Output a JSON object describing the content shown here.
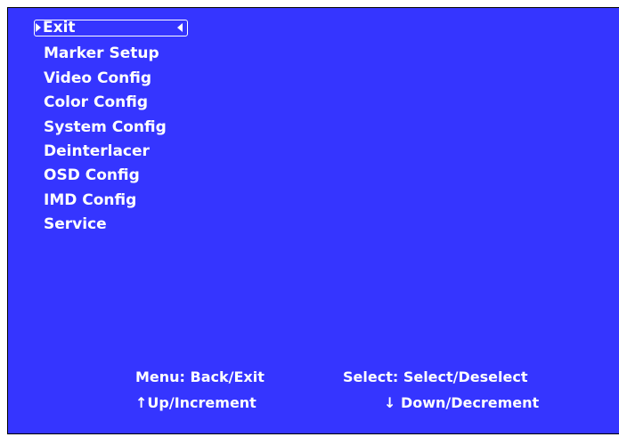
{
  "menu": {
    "items": [
      {
        "label": "Exit",
        "selected": true
      },
      {
        "label": "Marker Setup"
      },
      {
        "label": "Video Config"
      },
      {
        "label": "Color Config"
      },
      {
        "label": "System Config"
      },
      {
        "label": "Deinterlacer"
      },
      {
        "label": "OSD Config"
      },
      {
        "label": "IMD Config"
      },
      {
        "label": "Service"
      }
    ]
  },
  "help": {
    "menu_hint": "Menu: Back/Exit",
    "select_hint": "Select: Select/Deselect",
    "up_hint": "↑Up/Increment",
    "down_hint": "↓ Down/Decrement"
  },
  "colors": {
    "background": "#3535ff",
    "text": "#ffffff"
  },
  "icons": {
    "pointer": "pointer-right-icon",
    "back": "pointer-left-icon"
  }
}
